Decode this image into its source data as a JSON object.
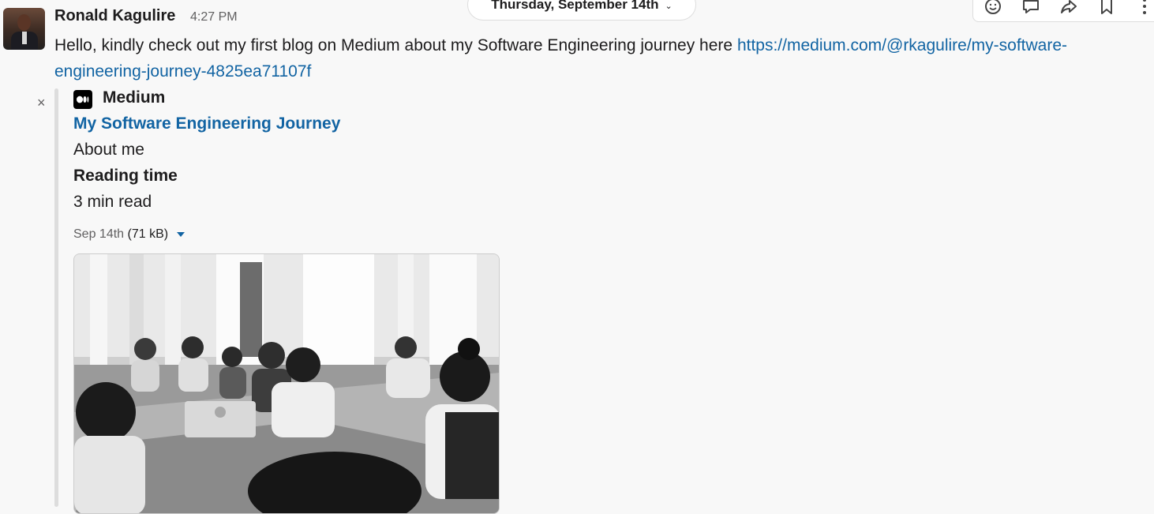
{
  "header": {
    "date_label": "Thursday, September 14th"
  },
  "message": {
    "sender": "Ronald Kagulire",
    "time": "4:27 PM",
    "text": "Hello, kindly check out my first blog on Medium about my Software Engineering journey here ",
    "link": "https://medium.com/@rkagulire/my-software-engineering-journey-4825ea71107f"
  },
  "unfurl": {
    "site": "Medium",
    "title": "My Software Engineering Journey",
    "description": "About me",
    "field_label": "Reading time",
    "field_value": "3 min read",
    "file_date": "Sep 14th",
    "file_size": "(71 kB)",
    "close_symbol": "×"
  },
  "icons": [
    "emoji-reaction-icon",
    "reply-in-thread-icon",
    "share-message-icon",
    "bookmark-icon",
    "more-actions-icon",
    "chevron-down-icon",
    "close-icon",
    "medium-logo-icon"
  ]
}
